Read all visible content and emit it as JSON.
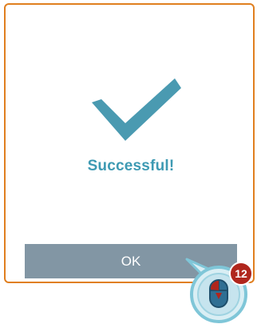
{
  "dialog": {
    "icon": "checkmark-icon",
    "message": "Successful!",
    "ok_label": "OK"
  },
  "callout": {
    "icon": "mouse-click-icon",
    "step_number": "12"
  },
  "colors": {
    "dialog_border": "#e07f1f",
    "checkmark": "#4a9ab1",
    "message_text": "#3e9ab3",
    "button_bg": "#8296a4",
    "callout_badge": "#b0261c",
    "callout_ring": "#7fc6d8"
  }
}
